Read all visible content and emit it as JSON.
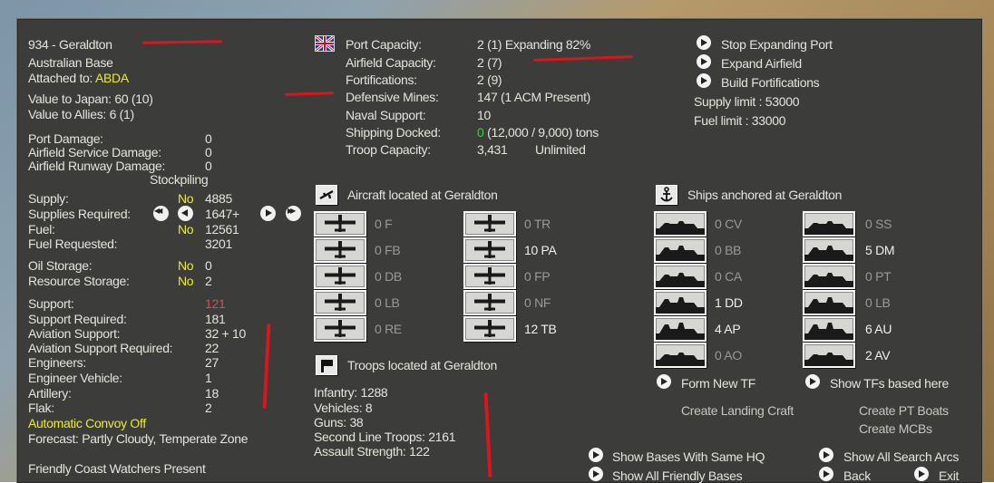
{
  "base": {
    "title": "934 - Geraldton",
    "type": "Australian Base",
    "attached_label": "Attached to:",
    "attached_value": "ABDA",
    "value_japan": "Value to Japan:  60 (10)",
    "value_allies": "Value to Allies:  6 (1)"
  },
  "damage": {
    "rows": [
      {
        "label": "Port Damage:",
        "value": "0"
      },
      {
        "label": "Airfield Service Damage:",
        "value": "0"
      },
      {
        "label": "Airfield Runway Damage:",
        "value": "0"
      }
    ],
    "stockpiling_label": "Stockpiling"
  },
  "supply": {
    "supply_label": "Supply:",
    "supply_flag": "No",
    "supply_value": "4885",
    "required_label": "Supplies Required:",
    "required_value": "1647+",
    "fuel_label": "Fuel:",
    "fuel_flag": "No",
    "fuel_value": "12561",
    "fuel_req_label": "Fuel Requested:",
    "fuel_req_value": "3201",
    "oil_label": "Oil Storage:",
    "oil_flag": "No",
    "oil_value": "0",
    "res_label": "Resource Storage:",
    "res_flag": "No",
    "res_value": "2"
  },
  "support": {
    "support_label": "Support:",
    "support_value": "121",
    "rows": [
      {
        "label": "Support Required:",
        "value": "181"
      },
      {
        "label": "Aviation Support:",
        "value": "32 + 10"
      },
      {
        "label": "Aviation Support Required:",
        "value": "22"
      },
      {
        "label": "Engineers:",
        "value": "27"
      },
      {
        "label": "Engineer Vehicle:",
        "value": "1"
      },
      {
        "label": "Artillery:",
        "value": "18"
      },
      {
        "label": "Flak:",
        "value": "2"
      }
    ],
    "convoy": "Automatic Convoy Off",
    "forecast": "Forecast: Partly Cloudy, Temperate Zone",
    "coast_watchers": "Friendly Coast Watchers Present"
  },
  "port": {
    "rows": [
      {
        "label": "Port Capacity:",
        "value": "2 (1) Expanding 82%"
      },
      {
        "label": "Airfield Capacity:",
        "value": "2 (7)"
      },
      {
        "label": "Fortifications:",
        "value": "2 (9)"
      },
      {
        "label": "Defensive Mines:",
        "value": "147 (1 ACM Present)"
      },
      {
        "label": "Naval Support:",
        "value": "10"
      },
      {
        "label": "Shipping Docked:",
        "value_green": "0",
        "value": "(12,000 / 9,000) tons"
      },
      {
        "label": "Troop Capacity:",
        "value": "3,431",
        "value2": "Unlimited"
      }
    ]
  },
  "actions": {
    "stop_expanding": "Stop Expanding Port",
    "expand_airfield": "Expand Airfield",
    "build_fort": "Build Fortifications",
    "supply_limit": "Supply limit : 53000",
    "fuel_limit": "Fuel limit : 33000"
  },
  "aircraft": {
    "title": "Aircraft located at Geraldton",
    "left": [
      "0 F",
      "0 FB",
      "0 DB",
      "0 LB",
      "0 RE"
    ],
    "right": [
      "0 TR",
      "10 PA",
      "0 FP",
      "0 NF",
      "12 TB"
    ]
  },
  "troops": {
    "title": "Troops located at Geraldton",
    "rows": [
      "Infantry: 1288",
      "Vehicles: 8",
      "Guns: 38",
      "Second Line Troops: 2161",
      "Assault Strength: 122"
    ]
  },
  "ships": {
    "title": "Ships anchored at Geraldton",
    "left": [
      "0 CV",
      "0 BB",
      "0 CA",
      "1 DD",
      "4 AP",
      "0 AO"
    ],
    "right": [
      "0 SS",
      "5 DM",
      "0 PT",
      "0 LB",
      "6 AU",
      "2 AV"
    ],
    "form_tf": "Form New TF",
    "show_tfs": "Show TFs based here",
    "create_landing": "Create Landing Craft",
    "create_pt": "Create PT Boats",
    "create_mcb": "Create MCBs"
  },
  "bottom": {
    "same_hq": "Show Bases With Same HQ",
    "friendly": "Show All Friendly Bases",
    "search_arcs": "Show All Search Arcs",
    "back": "Back",
    "exit": "Exit"
  },
  "colors": {
    "panel": "#3c3c3a",
    "highlight": "#ecec2c",
    "alert": "#e14a4a",
    "green": "#3cd23c",
    "annotation": "#d8161e"
  }
}
